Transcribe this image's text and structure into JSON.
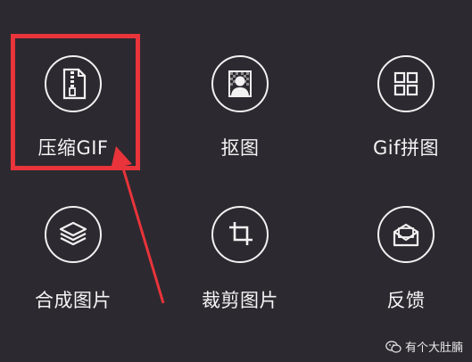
{
  "tools": [
    {
      "label": "压缩GIF",
      "icon": "zip-file-icon"
    },
    {
      "label": "抠图",
      "icon": "portrait-cutout-icon"
    },
    {
      "label": "Gif拼图",
      "icon": "grid-collage-icon"
    },
    {
      "label": "合成图片",
      "icon": "layers-icon"
    },
    {
      "label": "裁剪图片",
      "icon": "crop-icon"
    },
    {
      "label": "反馈",
      "icon": "mail-feedback-icon"
    }
  ],
  "watermark": {
    "text": "有个大肚腩",
    "icon": "wechat-icon"
  },
  "colors": {
    "background": "#2d2930",
    "highlight": "#e8343a",
    "foreground": "#f2f2f2"
  }
}
